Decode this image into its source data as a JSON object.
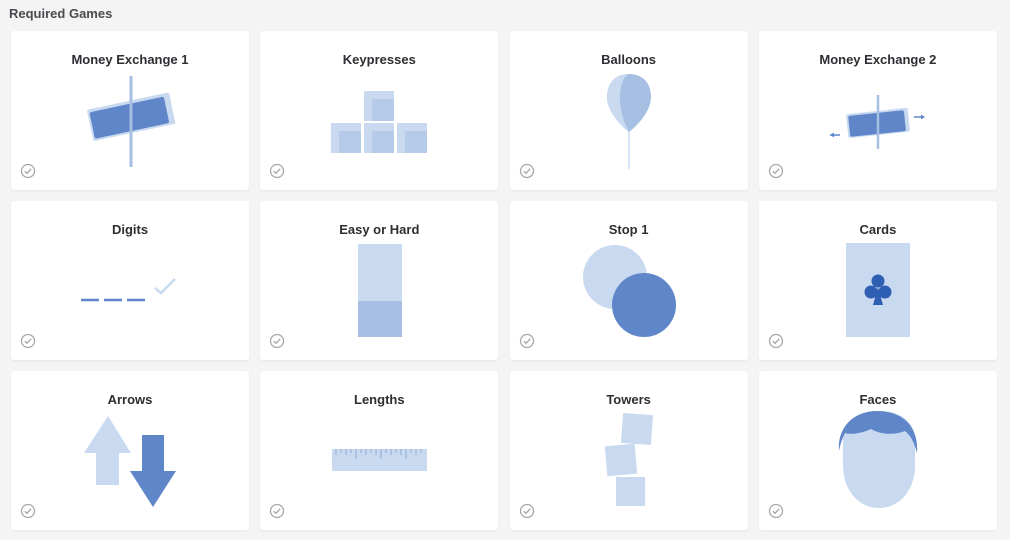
{
  "section": {
    "title": "Required Games"
  },
  "colors": {
    "light": "#c9daf0",
    "mid": "#a7bfe3",
    "dark": "#5e86c9",
    "check": "#a8a8a8"
  },
  "games": [
    {
      "title": "Money Exchange 1",
      "icon": "money-exchange-icon",
      "completed": true
    },
    {
      "title": "Keypresses",
      "icon": "keypresses-icon",
      "completed": true
    },
    {
      "title": "Balloons",
      "icon": "balloon-icon",
      "completed": true
    },
    {
      "title": "Money Exchange 2",
      "icon": "money-exchange-2-icon",
      "completed": true
    },
    {
      "title": "Digits",
      "icon": "digits-icon",
      "completed": true
    },
    {
      "title": "Easy or Hard",
      "icon": "easy-or-hard-icon",
      "completed": true
    },
    {
      "title": "Stop 1",
      "icon": "stop-icon",
      "completed": true
    },
    {
      "title": "Cards",
      "icon": "cards-icon",
      "completed": true
    },
    {
      "title": "Arrows",
      "icon": "arrows-icon",
      "completed": true
    },
    {
      "title": "Lengths",
      "icon": "ruler-icon",
      "completed": true
    },
    {
      "title": "Towers",
      "icon": "towers-icon",
      "completed": true
    },
    {
      "title": "Faces",
      "icon": "face-icon",
      "completed": true
    }
  ]
}
